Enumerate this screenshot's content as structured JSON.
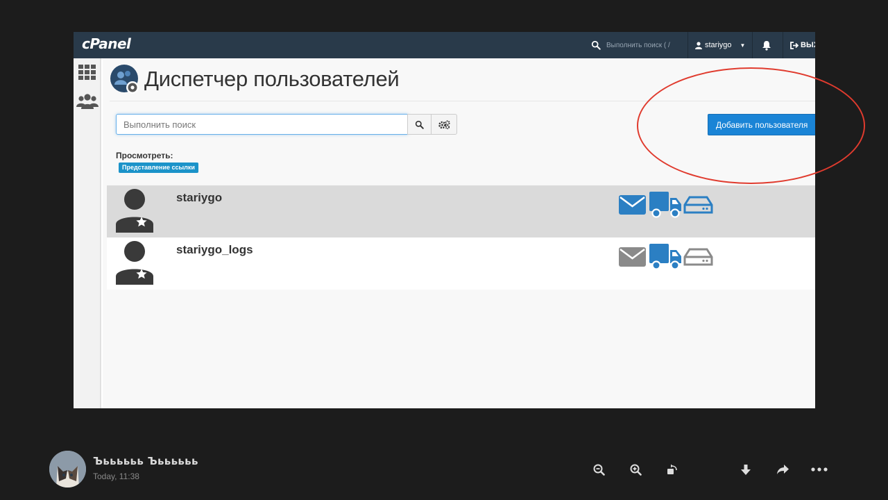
{
  "cpanel": {
    "logo": "cPanel",
    "topbar": {
      "search_placeholder": "Выполнить поиск ( /",
      "username": "stariygo",
      "logout_label": "ВЫХ"
    },
    "page_title": "Диспетчер пользователей",
    "search": {
      "placeholder": "Выполнить поиск"
    },
    "add_user_label": "Добавить пользователя",
    "view_label": "Просмотреть:",
    "view_badge": "Представление ссылки",
    "users": [
      {
        "name": "stariygo",
        "email_enabled": true,
        "ftp_enabled": true,
        "webdisk_enabled": true
      },
      {
        "name": "stariygo_logs",
        "email_enabled": false,
        "ftp_enabled": true,
        "webdisk_enabled": false
      }
    ],
    "colors": {
      "topbar": "#293a4a",
      "accent_blue": "#1a84d6",
      "service_active": "#2b7fc3",
      "service_inactive": "#8a8a8a",
      "annotation": "#e03b2e"
    }
  },
  "viewer": {
    "sender_name": "Ъьььььь Ъьььььь",
    "timestamp": "Today, 11:38",
    "tools": [
      "zoom-out-icon",
      "zoom-in-icon",
      "rotate-icon",
      "download-icon",
      "share-icon",
      "more-icon"
    ]
  }
}
